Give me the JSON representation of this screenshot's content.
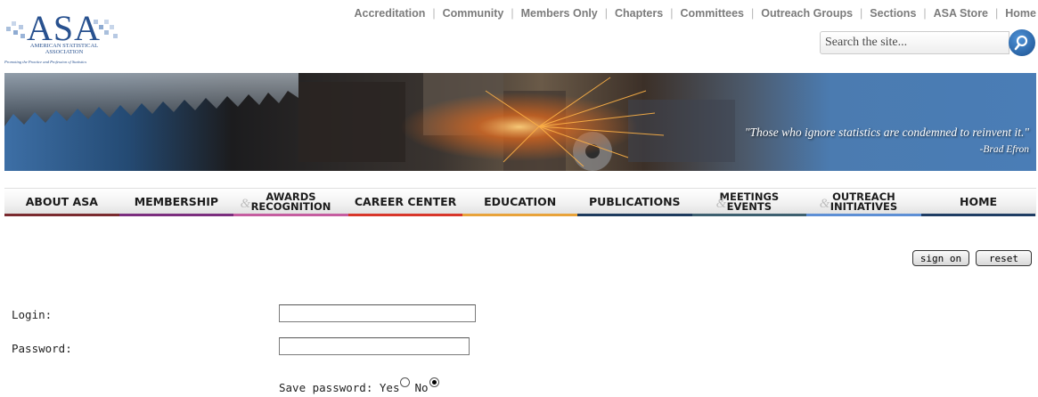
{
  "logo": {
    "wordmark": "ASA",
    "org_line1": "AMERICAN STATISTICAL",
    "org_line2": "ASSOCIATION",
    "tagline": "Promoting the Practice and Profession of Statistics"
  },
  "top_links": [
    "Accreditation",
    "Community",
    "Members Only",
    "Chapters",
    "Committees",
    "Outreach Groups",
    "Sections",
    "ASA Store",
    "Home"
  ],
  "search": {
    "value": "Search the site...",
    "button_icon": "search-arrow-icon"
  },
  "banner": {
    "quote": "\"Those who ignore statistics are condemned to reinvent it.\"",
    "attribution": "-Brad Efron"
  },
  "main_nav": [
    {
      "line1": "ABOUT ASA",
      "color": "#7a2a2f"
    },
    {
      "line1": "MEMBERSHIP",
      "color": "#7b2d7e"
    },
    {
      "amp": "&",
      "line1": "AWARDS",
      "line2": "RECOGNITION",
      "color": "#c55da0"
    },
    {
      "line1": "CAREER CENTER",
      "color": "#d8362a"
    },
    {
      "line1": "EDUCATION",
      "color": "#e8a33a"
    },
    {
      "line1": "PUBLICATIONS",
      "color": "#1d3b5e"
    },
    {
      "amp": "&",
      "line1": "MEETINGS",
      "line2": "EVENTS",
      "color": "#3d6070"
    },
    {
      "amp": "&",
      "line1": "OUTREACH",
      "line2": "INITIATIVES",
      "color": "#5d8fd5"
    },
    {
      "line1": "HOME",
      "color": "#1f3d64"
    }
  ],
  "form": {
    "sign_on_label": "sign on",
    "reset_label": "reset",
    "login_label": "Login:",
    "login_value": "",
    "password_label": "Password:",
    "password_value": "",
    "save_password_label": "Save password:",
    "yes_label": "Yes",
    "no_label": "No",
    "save_password_selected": "No"
  }
}
